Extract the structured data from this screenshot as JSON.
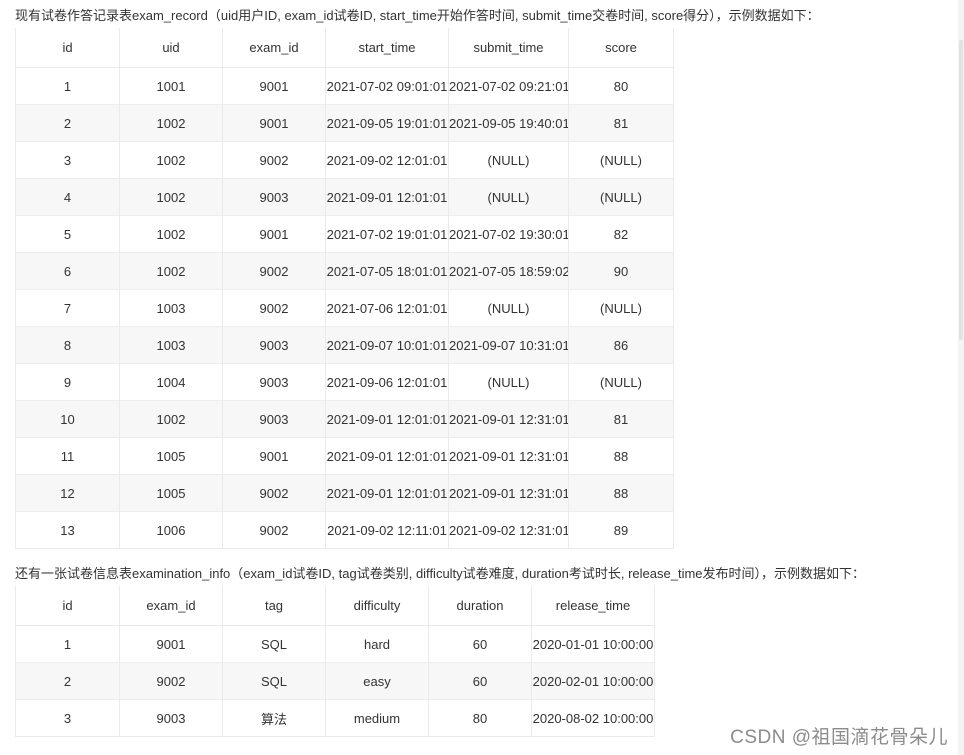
{
  "intro1": "现有试卷作答记录表exam_record（uid用户ID, exam_id试卷ID, start_time开始作答时间, submit_time交卷时间, score得分），示例数据如下：",
  "exam_record": {
    "columns": [
      "id",
      "uid",
      "exam_id",
      "start_time",
      "submit_time",
      "score"
    ],
    "rows": [
      [
        "1",
        "1001",
        "9001",
        "2021-07-02 09:01:01",
        "2021-07-02 09:21:01",
        "80"
      ],
      [
        "2",
        "1002",
        "9001",
        "2021-09-05 19:01:01",
        "2021-09-05 19:40:01",
        "81"
      ],
      [
        "3",
        "1002",
        "9002",
        "2021-09-02 12:01:01",
        "(NULL)",
        "(NULL)"
      ],
      [
        "4",
        "1002",
        "9003",
        "2021-09-01 12:01:01",
        "(NULL)",
        "(NULL)"
      ],
      [
        "5",
        "1002",
        "9001",
        "2021-07-02 19:01:01",
        "2021-07-02 19:30:01",
        "82"
      ],
      [
        "6",
        "1002",
        "9002",
        "2021-07-05 18:01:01",
        "2021-07-05 18:59:02",
        "90"
      ],
      [
        "7",
        "1003",
        "9002",
        "2021-07-06 12:01:01",
        "(NULL)",
        "(NULL)"
      ],
      [
        "8",
        "1003",
        "9003",
        "2021-09-07 10:01:01",
        "2021-09-07 10:31:01",
        "86"
      ],
      [
        "9",
        "1004",
        "9003",
        "2021-09-06 12:01:01",
        "(NULL)",
        "(NULL)"
      ],
      [
        "10",
        "1002",
        "9003",
        "2021-09-01 12:01:01",
        "2021-09-01 12:31:01",
        "81"
      ],
      [
        "11",
        "1005",
        "9001",
        "2021-09-01 12:01:01",
        "2021-09-01 12:31:01",
        "88"
      ],
      [
        "12",
        "1005",
        "9002",
        "2021-09-01 12:01:01",
        "2021-09-01 12:31:01",
        "88"
      ],
      [
        "13",
        "1006",
        "9002",
        "2021-09-02 12:11:01",
        "2021-09-02 12:31:01",
        "89"
      ]
    ]
  },
  "intro2": "还有一张试卷信息表examination_info（exam_id试卷ID, tag试卷类别, difficulty试卷难度, duration考试时长, release_time发布时间），示例数据如下：",
  "examination_info": {
    "columns": [
      "id",
      "exam_id",
      "tag",
      "difficulty",
      "duration",
      "release_time"
    ],
    "rows": [
      [
        "1",
        "9001",
        "SQL",
        "hard",
        "60",
        "2020-01-01 10:00:00"
      ],
      [
        "2",
        "9002",
        "SQL",
        "easy",
        "60",
        "2020-02-01 10:00:00"
      ],
      [
        "3",
        "9003",
        "算法",
        "medium",
        "80",
        "2020-08-02 10:00:00"
      ]
    ]
  },
  "watermark": "CSDN @祖国滴花骨朵儿"
}
